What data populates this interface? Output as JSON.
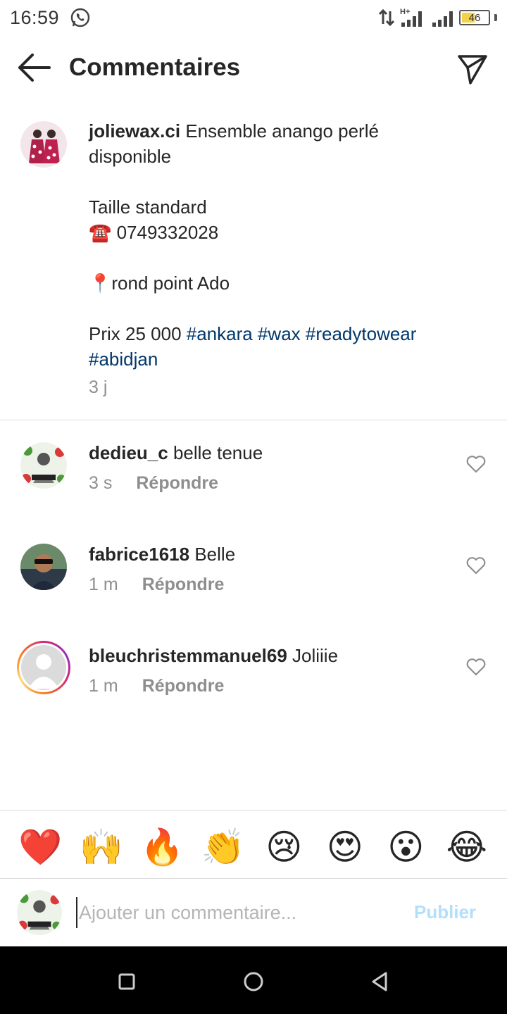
{
  "status_bar": {
    "time": "16:59",
    "battery": "46",
    "network": "H+"
  },
  "header": {
    "title": "Commentaires"
  },
  "caption": {
    "username": "joliewax.ci",
    "text_lines": "Ensemble anango perlé\ndisponible\n\nTaille standard\n☎️ 0749332028\n\n📍rond point Ado\n\nPrix 25 000 ",
    "hashtags": [
      "#ankara",
      "#wax",
      "#readytowear",
      "#abidjan"
    ],
    "time": "3 j"
  },
  "comments": [
    {
      "username": "dedieu_c",
      "text": "belle tenue",
      "time": "3 s",
      "reply": "Répondre"
    },
    {
      "username": "fabrice1618",
      "text": "Belle",
      "time": "1 m",
      "reply": "Répondre"
    },
    {
      "username": "bleuchristemmanuel69",
      "text": "Joliiie",
      "time": "1 m",
      "reply": "Répondre"
    }
  ],
  "reactions": [
    "❤️",
    "🙌",
    "🔥",
    "👏",
    "😢",
    "😍",
    "😮",
    "😂"
  ],
  "composer": {
    "placeholder": "Ajouter un commentaire...",
    "publish_label": "Publier"
  },
  "colors": {
    "hashtag": "#00376b",
    "meta": "#8e8e8e",
    "publish_disabled": "#b2dffc"
  },
  "icons": {
    "back": "arrow-left-icon",
    "share": "paper-plane-icon",
    "like": "heart-outline-icon"
  }
}
